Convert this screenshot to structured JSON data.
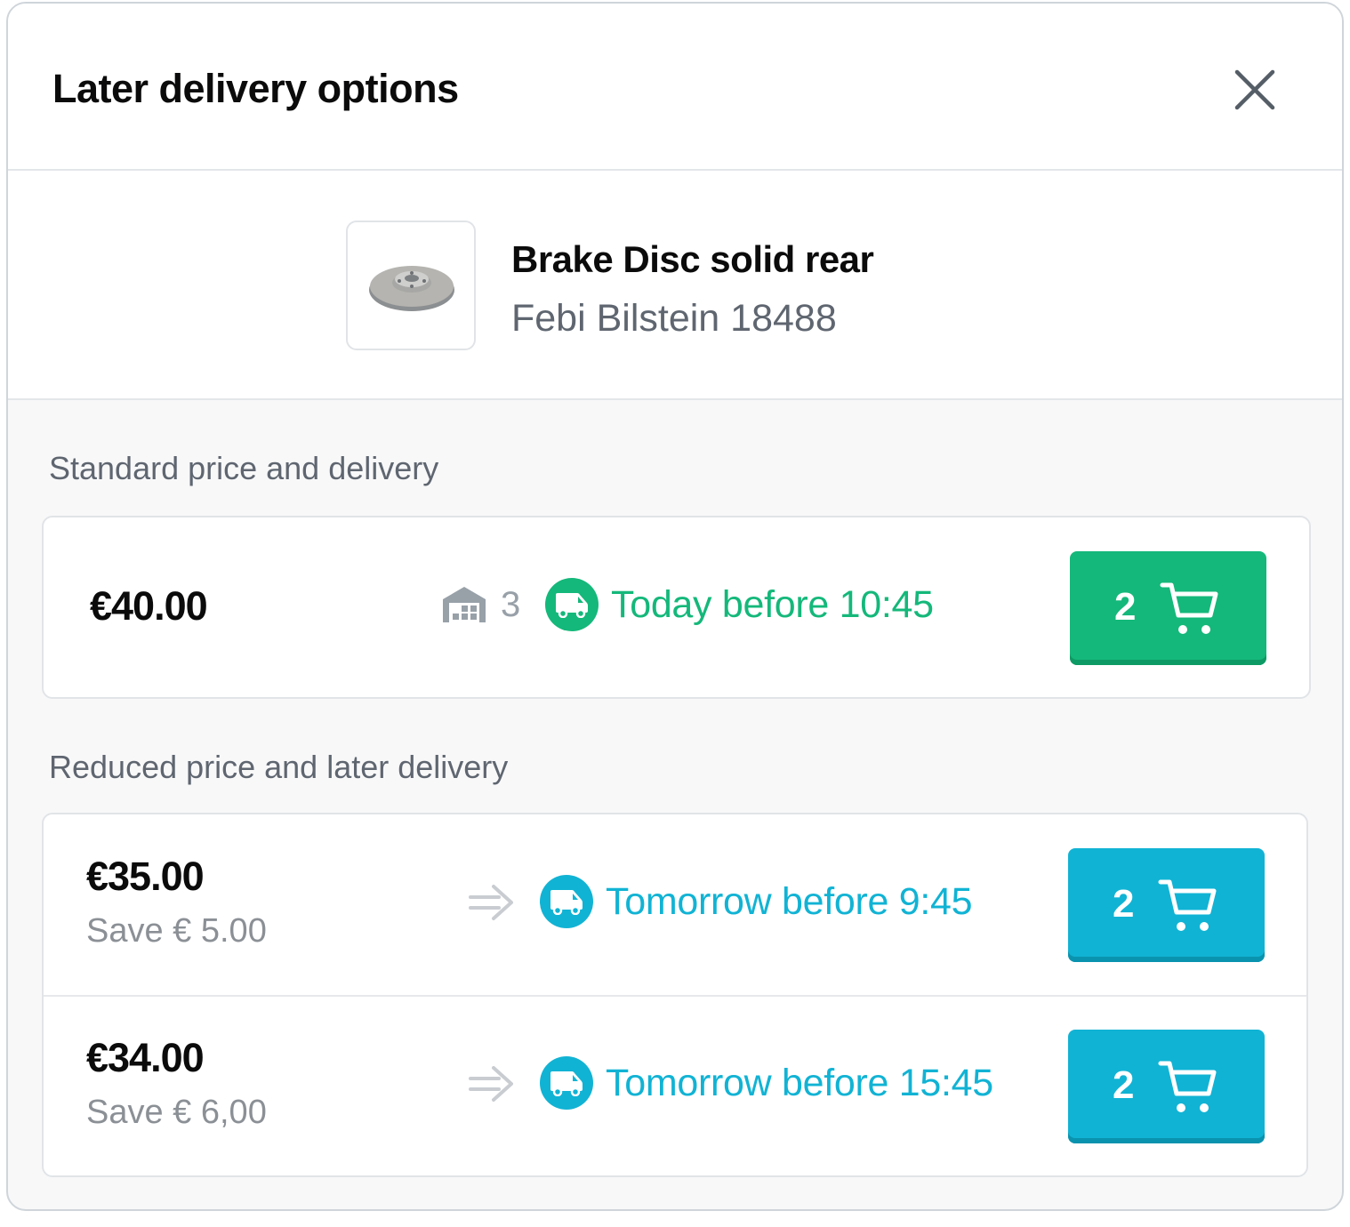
{
  "modal": {
    "title": "Later delivery options"
  },
  "product": {
    "name": "Brake Disc solid rear",
    "brand": "Febi Bilstein 18488"
  },
  "colors": {
    "green": "#14b87a",
    "green_dark": "#0e9a64",
    "cyan": "#11b3d4",
    "cyan_dark": "#0a93ae"
  },
  "standard": {
    "section_label": "Standard price and delivery",
    "price": "€40.00",
    "stock_icon": "warehouse-icon",
    "stock_count": "3",
    "delivery": "Today before 10:45",
    "cart_qty": "2"
  },
  "reduced": {
    "section_label": "Reduced price and later delivery",
    "options": [
      {
        "price": "€35.00",
        "save": "Save € 5.00",
        "delivery": "Tomorrow before 9:45",
        "cart_qty": "2"
      },
      {
        "price": "€34.00",
        "save": "Save € 6,00",
        "delivery": "Tomorrow before 15:45",
        "cart_qty": "2"
      }
    ]
  }
}
